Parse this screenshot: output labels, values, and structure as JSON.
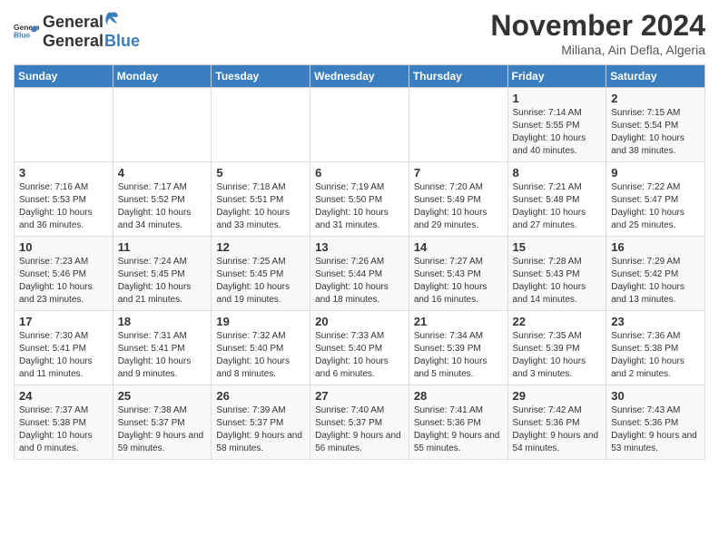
{
  "header": {
    "logo_general": "General",
    "logo_blue": "Blue",
    "month_title": "November 2024",
    "location": "Miliana, Ain Defla, Algeria"
  },
  "weekdays": [
    "Sunday",
    "Monday",
    "Tuesday",
    "Wednesday",
    "Thursday",
    "Friday",
    "Saturday"
  ],
  "weeks": [
    [
      {
        "day": "",
        "info": ""
      },
      {
        "day": "",
        "info": ""
      },
      {
        "day": "",
        "info": ""
      },
      {
        "day": "",
        "info": ""
      },
      {
        "day": "",
        "info": ""
      },
      {
        "day": "1",
        "info": "Sunrise: 7:14 AM\nSunset: 5:55 PM\nDaylight: 10 hours and 40 minutes."
      },
      {
        "day": "2",
        "info": "Sunrise: 7:15 AM\nSunset: 5:54 PM\nDaylight: 10 hours and 38 minutes."
      }
    ],
    [
      {
        "day": "3",
        "info": "Sunrise: 7:16 AM\nSunset: 5:53 PM\nDaylight: 10 hours and 36 minutes."
      },
      {
        "day": "4",
        "info": "Sunrise: 7:17 AM\nSunset: 5:52 PM\nDaylight: 10 hours and 34 minutes."
      },
      {
        "day": "5",
        "info": "Sunrise: 7:18 AM\nSunset: 5:51 PM\nDaylight: 10 hours and 33 minutes."
      },
      {
        "day": "6",
        "info": "Sunrise: 7:19 AM\nSunset: 5:50 PM\nDaylight: 10 hours and 31 minutes."
      },
      {
        "day": "7",
        "info": "Sunrise: 7:20 AM\nSunset: 5:49 PM\nDaylight: 10 hours and 29 minutes."
      },
      {
        "day": "8",
        "info": "Sunrise: 7:21 AM\nSunset: 5:48 PM\nDaylight: 10 hours and 27 minutes."
      },
      {
        "day": "9",
        "info": "Sunrise: 7:22 AM\nSunset: 5:47 PM\nDaylight: 10 hours and 25 minutes."
      }
    ],
    [
      {
        "day": "10",
        "info": "Sunrise: 7:23 AM\nSunset: 5:46 PM\nDaylight: 10 hours and 23 minutes."
      },
      {
        "day": "11",
        "info": "Sunrise: 7:24 AM\nSunset: 5:45 PM\nDaylight: 10 hours and 21 minutes."
      },
      {
        "day": "12",
        "info": "Sunrise: 7:25 AM\nSunset: 5:45 PM\nDaylight: 10 hours and 19 minutes."
      },
      {
        "day": "13",
        "info": "Sunrise: 7:26 AM\nSunset: 5:44 PM\nDaylight: 10 hours and 18 minutes."
      },
      {
        "day": "14",
        "info": "Sunrise: 7:27 AM\nSunset: 5:43 PM\nDaylight: 10 hours and 16 minutes."
      },
      {
        "day": "15",
        "info": "Sunrise: 7:28 AM\nSunset: 5:43 PM\nDaylight: 10 hours and 14 minutes."
      },
      {
        "day": "16",
        "info": "Sunrise: 7:29 AM\nSunset: 5:42 PM\nDaylight: 10 hours and 13 minutes."
      }
    ],
    [
      {
        "day": "17",
        "info": "Sunrise: 7:30 AM\nSunset: 5:41 PM\nDaylight: 10 hours and 11 minutes."
      },
      {
        "day": "18",
        "info": "Sunrise: 7:31 AM\nSunset: 5:41 PM\nDaylight: 10 hours and 9 minutes."
      },
      {
        "day": "19",
        "info": "Sunrise: 7:32 AM\nSunset: 5:40 PM\nDaylight: 10 hours and 8 minutes."
      },
      {
        "day": "20",
        "info": "Sunrise: 7:33 AM\nSunset: 5:40 PM\nDaylight: 10 hours and 6 minutes."
      },
      {
        "day": "21",
        "info": "Sunrise: 7:34 AM\nSunset: 5:39 PM\nDaylight: 10 hours and 5 minutes."
      },
      {
        "day": "22",
        "info": "Sunrise: 7:35 AM\nSunset: 5:39 PM\nDaylight: 10 hours and 3 minutes."
      },
      {
        "day": "23",
        "info": "Sunrise: 7:36 AM\nSunset: 5:38 PM\nDaylight: 10 hours and 2 minutes."
      }
    ],
    [
      {
        "day": "24",
        "info": "Sunrise: 7:37 AM\nSunset: 5:38 PM\nDaylight: 10 hours and 0 minutes."
      },
      {
        "day": "25",
        "info": "Sunrise: 7:38 AM\nSunset: 5:37 PM\nDaylight: 9 hours and 59 minutes."
      },
      {
        "day": "26",
        "info": "Sunrise: 7:39 AM\nSunset: 5:37 PM\nDaylight: 9 hours and 58 minutes."
      },
      {
        "day": "27",
        "info": "Sunrise: 7:40 AM\nSunset: 5:37 PM\nDaylight: 9 hours and 56 minutes."
      },
      {
        "day": "28",
        "info": "Sunrise: 7:41 AM\nSunset: 5:36 PM\nDaylight: 9 hours and 55 minutes."
      },
      {
        "day": "29",
        "info": "Sunrise: 7:42 AM\nSunset: 5:36 PM\nDaylight: 9 hours and 54 minutes."
      },
      {
        "day": "30",
        "info": "Sunrise: 7:43 AM\nSunset: 5:36 PM\nDaylight: 9 hours and 53 minutes."
      }
    ]
  ]
}
